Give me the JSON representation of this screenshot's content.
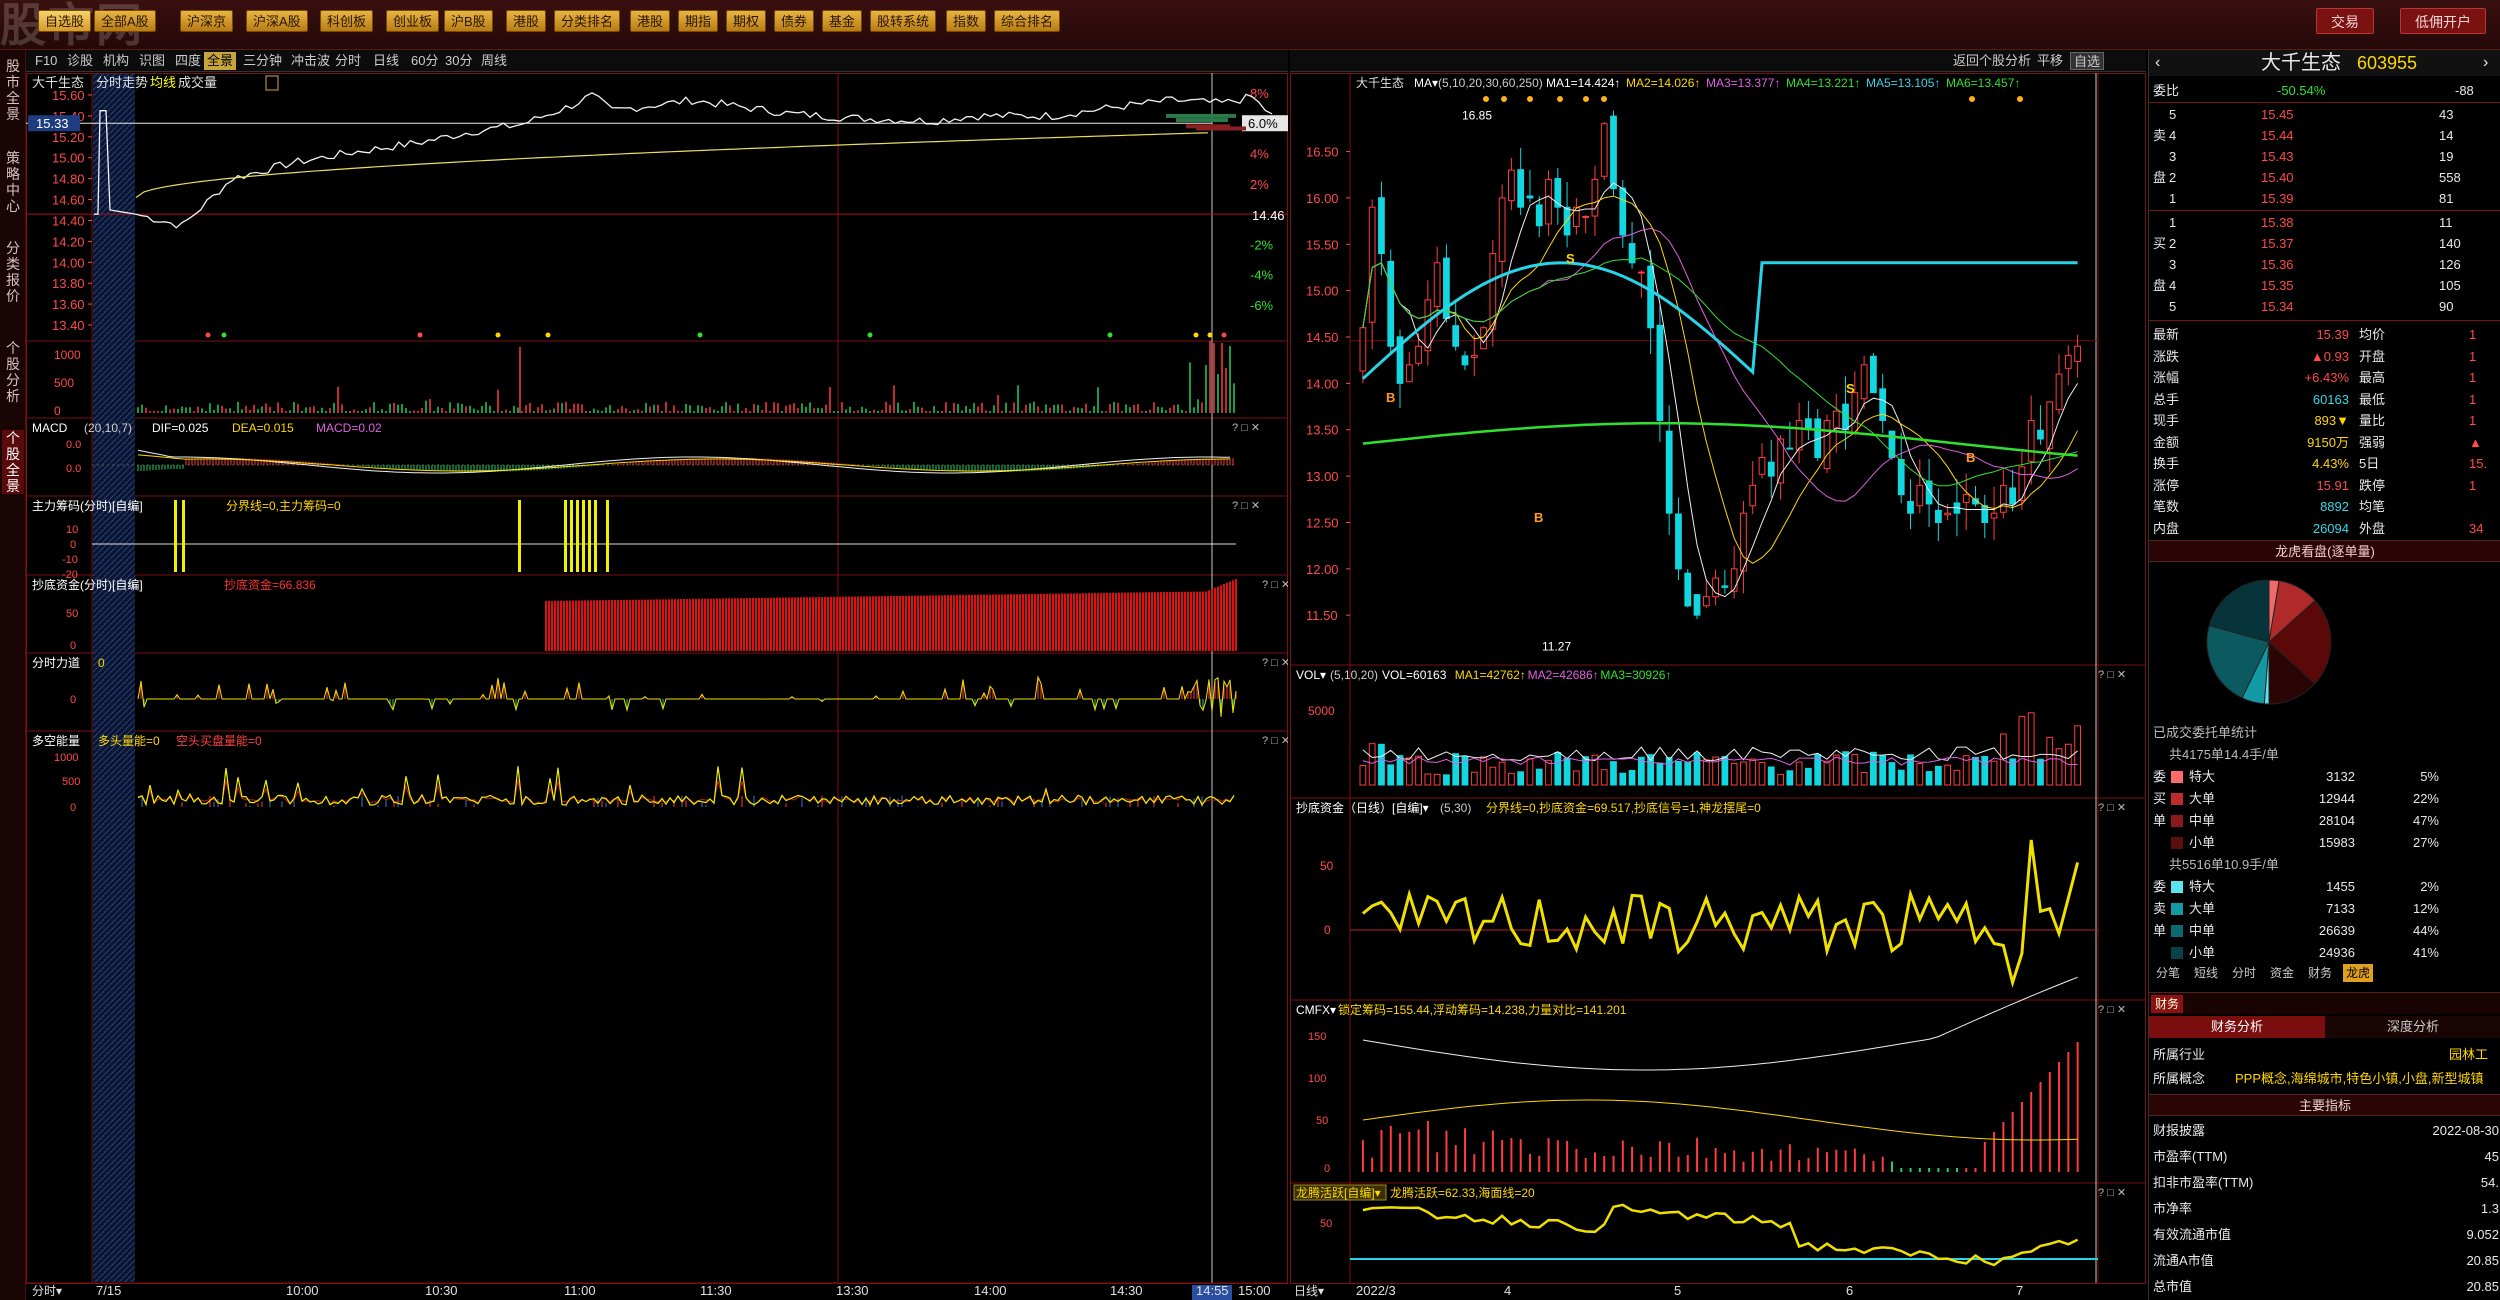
{
  "topbar": {
    "logo_text": "股市网",
    "menu": [
      "自选股",
      "全部A股",
      "沪深京",
      "沪深A股",
      "科创板",
      "创业板",
      "沪B股",
      "港股",
      "分类排名",
      "港股",
      "期指",
      "期权",
      "债券",
      "基金",
      "股转系统",
      "指数",
      "综合排名"
    ],
    "trade_button": "交易",
    "open_account_button": "低佣开户"
  },
  "leftrail": [
    "股市全景",
    "策略中心",
    "分类报价",
    "个股分析",
    "个股全景"
  ],
  "subbar": {
    "left_items": [
      "F10",
      "诊股",
      "机构",
      "识图",
      "四度",
      "全景",
      "三分钟",
      "冲击波",
      "分时",
      "日线",
      "60分",
      "30分",
      "周线"
    ],
    "right_items": [
      "返回个股分析",
      "平移",
      "自选"
    ],
    "active": "全景"
  },
  "intraday": {
    "header_name": "大千生态",
    "header_tags": [
      "分时走势",
      "均线",
      "成交量"
    ],
    "price_ticks": [
      "15.60",
      "15.40",
      "15.20",
      "15.00",
      "14.80",
      "14.60",
      "14.40",
      "14.20",
      "14.00",
      "13.80",
      "13.60",
      "13.40"
    ],
    "current_price_tag": "15.33",
    "pct_ticks": [
      "8%",
      "6%",
      "4%",
      "2%",
      "",
      "-2%",
      "-4%",
      "-6%"
    ],
    "prev_close": "14.46",
    "pct_tag": "6.0%",
    "vol_ticks": [
      "1000",
      "500",
      "0"
    ],
    "time_labels": [
      "7/15",
      "10:00",
      "10:30",
      "11:00",
      "11:30",
      "13:30",
      "14:00",
      "14:30",
      "14:55",
      "15:00"
    ],
    "bottom_left": "分时",
    "macd_title": "MACD",
    "macd_params": "(20,10,7)",
    "macd_dif": "DIF=0.025",
    "macd_dea": "DEA=0.015",
    "macd_val": "MACD=0.02",
    "macd_ticks": [
      "0.0",
      "0.0"
    ],
    "zlcm_title": "主力筹码(分时)[自编]",
    "zlcm_vals": "分界线=0,主力筹码=0",
    "zlcm_ticks": [
      "10",
      "0",
      "-10",
      "-20"
    ],
    "cdzj_title": "抄底资金(分时)[自编]",
    "cdzj_val": "抄底资金=66.836",
    "cdzj_ticks": [
      "50",
      "0"
    ],
    "fsld_title": "分时力道",
    "fsld_val": "0",
    "fsld_ticks": [
      "0"
    ],
    "dknl_title": "多空能量",
    "dknl_val1": "多头量能=0",
    "dknl_val2": "空头买盘量能=0",
    "dknl_ticks": [
      "1000",
      "500",
      "0"
    ]
  },
  "kline": {
    "header_name": "大千生态",
    "ma_title": "MA",
    "ma_params": "(5,10,20,30,60,250)",
    "ma_vals": [
      "MA1=14.424",
      "MA2=14.026",
      "MA3=13.377",
      "MA4=13.221",
      "MA5=13.105",
      "MA6=13.457"
    ],
    "price_ticks": [
      "16.50",
      "16.00",
      "15.50",
      "15.00",
      "14.50",
      "14.00",
      "13.50",
      "13.00",
      "12.50",
      "12.00",
      "11.50"
    ],
    "high_label": "16.85",
    "low_label": "11.27",
    "vol_title": "VOL",
    "vol_params": "(5,10,20)",
    "vol_vals": [
      "VOL=60163",
      "MA1=42762",
      "MA2=42686",
      "MA3=30926"
    ],
    "vol_ticks": [
      "5000"
    ],
    "cdzj_title": "抄底资金（日线）[自编]",
    "cdzj_params": "(5,30)",
    "cdzj_vals": "分界线=0,抄底资金=69.517,抄底信号=1,神龙摆尾=0",
    "cdzj_ticks": [
      "50",
      "0"
    ],
    "cmfx_title": "CMFX",
    "cmfx_vals": "锁定筹码=155.44,浮动筹码=14.238,力量对比=141.201",
    "cmfx_ticks": [
      "150",
      "100",
      "50",
      "0"
    ],
    "lths_title": "龙腾活跃[自编]",
    "lths_vals": "龙腾活跃=62.33,海面线=20",
    "lths_ticks": [
      "50"
    ],
    "date_labels": [
      "2022/3",
      "4",
      "5",
      "6",
      "7"
    ],
    "bottom_left": "日线"
  },
  "quote": {
    "name": "大千生态",
    "code": "603955",
    "webi_label": "委比",
    "webi_val": "-50.54%",
    "webi_right": "-88",
    "sell": [
      {
        "lvl": "5",
        "price": "15.45",
        "vol": "43"
      },
      {
        "lvl": "4",
        "price": "15.44",
        "vol": "14"
      },
      {
        "lvl": "3",
        "price": "15.43",
        "vol": "19"
      },
      {
        "lvl": "2",
        "price": "15.40",
        "vol": "558"
      },
      {
        "lvl": "1",
        "price": "15.39",
        "vol": "81"
      }
    ],
    "buy": [
      {
        "lvl": "1",
        "price": "15.38",
        "vol": "11"
      },
      {
        "lvl": "2",
        "price": "15.37",
        "vol": "140"
      },
      {
        "lvl": "3",
        "price": "15.36",
        "vol": "126"
      },
      {
        "lvl": "4",
        "price": "15.35",
        "vol": "105"
      },
      {
        "lvl": "5",
        "price": "15.34",
        "vol": "90"
      }
    ],
    "stats": [
      {
        "l": "最新",
        "v": "15.39",
        "l2": "均价",
        "v2": "1"
      },
      {
        "l": "涨跌",
        "v": "▲0.93",
        "l2": "开盘",
        "v2": "1"
      },
      {
        "l": "涨幅",
        "v": "+6.43%",
        "l2": "最高",
        "v2": "1"
      },
      {
        "l": "总手",
        "v": "60163",
        "l2": "最低",
        "v2": "1"
      },
      {
        "l": "现手",
        "v": "893▼",
        "l2": "量比",
        "v2": "1"
      },
      {
        "l": "金额",
        "v": "9150万",
        "l2": "强弱",
        "v2": "▲"
      },
      {
        "l": "换手",
        "v": "4.43%",
        "l2": "5日",
        "v2": "15."
      },
      {
        "l": "涨停",
        "v": "15.91",
        "l2": "跌停",
        "v2": "1"
      },
      {
        "l": "笔数",
        "v": "8892",
        "l2": "均笔",
        "v2": ""
      },
      {
        "l": "内盘",
        "v": "26094",
        "l2": "外盘",
        "v2": "34"
      }
    ],
    "dragon_title": "龙虎看盘(逐单量)",
    "deal_title": "已成交委托单统计",
    "buy_total": "共4175单14.4手/单",
    "buy_rows": [
      {
        "lab": "特大",
        "vol": "3132",
        "pct": "5%"
      },
      {
        "lab": "大单",
        "vol": "12944",
        "pct": "22%"
      },
      {
        "lab": "中单",
        "vol": "28104",
        "pct": "47%"
      },
      {
        "lab": "小单",
        "vol": "15983",
        "pct": "27%"
      }
    ],
    "buy_side_chars": [
      "委",
      "买",
      "单"
    ],
    "sell_total": "共5516单10.9手/单",
    "sell_rows": [
      {
        "lab": "特大",
        "vol": "1455",
        "pct": "2%"
      },
      {
        "lab": "大单",
        "vol": "7133",
        "pct": "12%"
      },
      {
        "lab": "中单",
        "vol": "26639",
        "pct": "44%"
      },
      {
        "lab": "小单",
        "vol": "24936",
        "pct": "41%"
      }
    ],
    "sell_side_chars": [
      "委",
      "卖",
      "单"
    ],
    "tabs": [
      "分笔",
      "短线",
      "分时",
      "资金",
      "财务",
      "龙虎"
    ],
    "tab_active": "龙虎",
    "fin_tab": "财务",
    "fin_analysis": "财务分析",
    "depth_analysis": "深度分析",
    "industry_label": "所属行业",
    "industry_val": "园林工",
    "concept_label": "所属概念",
    "concept_val": "PPP概念,海绵城市,特色小镇,小盘,新型城镇",
    "main_index": "主要指标",
    "fin": [
      {
        "l": "财报披露",
        "v": "2022-08-30"
      },
      {
        "l": "市盈率(TTM)",
        "v": "45"
      },
      {
        "l": "扣非市盈率(TTM)",
        "v": "54."
      },
      {
        "l": "市净率",
        "v": "1.3"
      },
      {
        "l": "有效流通市值",
        "v": "9.052"
      },
      {
        "l": "流通A市值",
        "v": "20.85"
      },
      {
        "l": "总市值",
        "v": "20.85"
      }
    ],
    "pie": [
      0.05,
      0.22,
      0.47,
      0.27
    ]
  },
  "colors": {
    "up": "#ff3c3c",
    "down": "#12d6e0",
    "yellow": "#f4f000",
    "bg": "#000000"
  }
}
